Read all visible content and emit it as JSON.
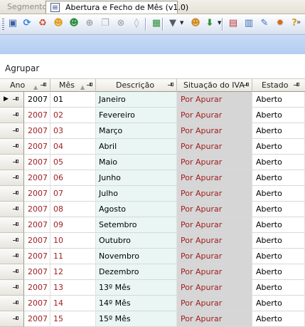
{
  "tabs": [
    {
      "label": "Segmento",
      "active": false
    },
    {
      "label": "Abertura e Fecho de Mês (v1.0)",
      "active": true
    }
  ],
  "toolbar": {
    "buttons": [
      {
        "icon": "save-icon",
        "color": "#3a5fa8"
      },
      {
        "icon": "refresh-icon",
        "color": "#2f7fd8"
      },
      {
        "icon": "recycle-icon",
        "color": "#d24a2a"
      },
      {
        "icon": "users-icon",
        "color": "#e0a020"
      },
      {
        "icon": "group-icon",
        "color": "#2f8f3a"
      },
      {
        "icon": "add-icon",
        "color": "#9aa0a8"
      },
      {
        "icon": "copy-icon",
        "color": "#a8adb5"
      },
      {
        "icon": "delete-icon",
        "color": "#a8adb5"
      },
      {
        "icon": "clear-icon",
        "color": "#a8adb5"
      },
      {
        "icon": "export-excel-icon",
        "color": "#2f8f3a"
      },
      {
        "icon": "filter-icon",
        "color": "#555b66"
      },
      {
        "icon": "user-lock-icon",
        "color": "#d08a20"
      },
      {
        "icon": "import-icon",
        "color": "#2f8f3a"
      },
      {
        "icon": "calendar-icon",
        "color": "#c03030"
      },
      {
        "icon": "calculator-icon",
        "color": "#3a6fb8"
      },
      {
        "icon": "edit-icon",
        "color": "#3a6fb8"
      },
      {
        "icon": "settings-icon",
        "color": "#d06a20"
      },
      {
        "icon": "help-icon",
        "color": "#d8a020"
      }
    ]
  },
  "group_area": {
    "label": "Agrupar"
  },
  "grid": {
    "columns": [
      {
        "key": "ano",
        "label": "Ano"
      },
      {
        "key": "mes",
        "label": "Mês"
      },
      {
        "key": "descricao",
        "label": "Descrição"
      },
      {
        "key": "situacao_iva",
        "label": "Situação do IVA"
      },
      {
        "key": "estado",
        "label": "Estado"
      }
    ],
    "current_row": 0,
    "rows": [
      {
        "ano": "2007",
        "mes": "01",
        "descricao": "Janeiro",
        "situacao_iva": "Por Apurar",
        "estado": "Aberto"
      },
      {
        "ano": "2007",
        "mes": "02",
        "descricao": "Fevereiro",
        "situacao_iva": "Por Apurar",
        "estado": "Aberto"
      },
      {
        "ano": "2007",
        "mes": "03",
        "descricao": "Março",
        "situacao_iva": "Por Apurar",
        "estado": "Aberto"
      },
      {
        "ano": "2007",
        "mes": "04",
        "descricao": "Abril",
        "situacao_iva": "Por Apurar",
        "estado": "Aberto"
      },
      {
        "ano": "2007",
        "mes": "05",
        "descricao": "Maio",
        "situacao_iva": "Por Apurar",
        "estado": "Aberto"
      },
      {
        "ano": "2007",
        "mes": "06",
        "descricao": "Junho",
        "situacao_iva": "Por Apurar",
        "estado": "Aberto"
      },
      {
        "ano": "2007",
        "mes": "07",
        "descricao": "Julho",
        "situacao_iva": "Por Apurar",
        "estado": "Aberto"
      },
      {
        "ano": "2007",
        "mes": "08",
        "descricao": "Agosto",
        "situacao_iva": "Por Apurar",
        "estado": "Aberto"
      },
      {
        "ano": "2007",
        "mes": "09",
        "descricao": "Setembro",
        "situacao_iva": "Por Apurar",
        "estado": "Aberto"
      },
      {
        "ano": "2007",
        "mes": "10",
        "descricao": "Outubro",
        "situacao_iva": "Por Apurar",
        "estado": "Aberto"
      },
      {
        "ano": "2007",
        "mes": "11",
        "descricao": "Novembro",
        "situacao_iva": "Por Apurar",
        "estado": "Aberto"
      },
      {
        "ano": "2007",
        "mes": "12",
        "descricao": "Dezembro",
        "situacao_iva": "Por Apurar",
        "estado": "Aberto"
      },
      {
        "ano": "2007",
        "mes": "13",
        "descricao": "13º Mês",
        "situacao_iva": "Por Apurar",
        "estado": "Aberto"
      },
      {
        "ano": "2007",
        "mes": "14",
        "descricao": "14º Mês",
        "situacao_iva": "Por Apurar",
        "estado": "Aberto"
      },
      {
        "ano": "2007",
        "mes": "15",
        "descricao": "15º Mês",
        "situacao_iva": "Por Apurar",
        "estado": "Aberto"
      }
    ]
  },
  "colors": {
    "accent_red": "#a02020",
    "toolbar_band": "#b3cdf2",
    "description_bg": "#eaf6f4",
    "iva_bg": "#d6d6d6"
  }
}
